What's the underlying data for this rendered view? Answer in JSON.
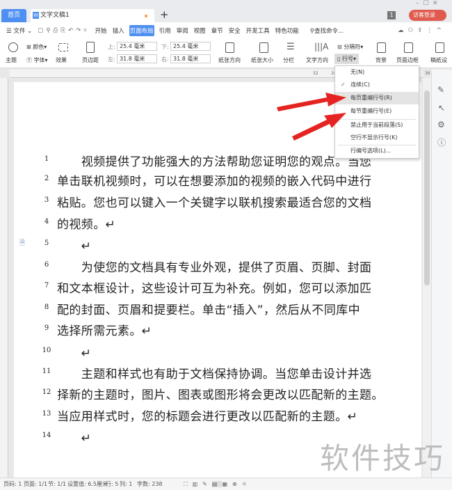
{
  "tabs": {
    "home": "首页",
    "doc": "文字文稿1",
    "badge": "1",
    "login": "访客登录",
    "new_tab": "+"
  },
  "menu": {
    "file": "文件",
    "items": [
      "开始",
      "插入",
      "页面布局",
      "引用",
      "审阅",
      "视图",
      "章节",
      "安全",
      "开发工具",
      "特色功能"
    ],
    "active": "页面布局",
    "search": "查找命令..."
  },
  "ribbon": {
    "theme": "主题",
    "color": "颜色",
    "font": "字体",
    "effect": "效果",
    "margins": "页边距",
    "top_label": "上:",
    "top": "25.4 毫米",
    "bottom_label": "下:",
    "bottom": "25.4 毫米",
    "left_label": "左:",
    "left": "31.8 毫米",
    "right_label": "右:",
    "right": "31.8 毫米",
    "orientation": "纸张方向",
    "size": "纸张大小",
    "columns": "分栏",
    "text_dir": "文字方向",
    "breaks": "分隔符",
    "line_numbers": "行号",
    "background": "背景",
    "page_border": "页面边框",
    "manuscript": "稿纸设"
  },
  "ruler": [
    "32",
    "34",
    "36"
  ],
  "dropdown": {
    "items": [
      "无(N)",
      "连续(C)",
      "每页重编行号(R)",
      "每节重编行号(E)",
      "禁止用于当前段落(S)",
      "空行不显示行号(K)",
      "行编号选项(L)..."
    ],
    "checked": "连续(C)",
    "highlighted": "每页重编行号(R)"
  },
  "document": {
    "lines": [
      {
        "n": "1",
        "t": "　　视频提供了功能强大的方法帮助您证明您的观点。当您"
      },
      {
        "n": "2",
        "t": "单击联机视频时，可以在想要添加的视频的嵌入代码中进行"
      },
      {
        "n": "3",
        "t": "粘贴。您也可以键入一个关键字以联机搜索最适合您的文档"
      },
      {
        "n": "4",
        "t": "的视频。↵"
      },
      {
        "n": "5",
        "t": "　　↵"
      },
      {
        "n": "6",
        "t": "　　为使您的文档具有专业外观，提供了页眉、页脚、封面"
      },
      {
        "n": "7",
        "t": "和文本框设计，这些设计可互为补充。例如，您可以添加匹"
      },
      {
        "n": "8",
        "t": "配的封面、页眉和提要栏。单击“插入”，然后从不同库中"
      },
      {
        "n": "9",
        "t": "选择所需元素。↵"
      },
      {
        "n": "10",
        "t": "　　↵"
      },
      {
        "n": "11",
        "t": "　　主题和样式也有助于文档保持协调。当您单击设计并选"
      },
      {
        "n": "12",
        "t": "择新的主题时，图片、图表或图形将会更改以匹配新的主题。"
      },
      {
        "n": "13",
        "t": "当应用样式时，您的标题会进行更改以匹配新的主题。↵"
      },
      {
        "n": "14",
        "t": "　　↵"
      }
    ]
  },
  "status": {
    "page": "页码: 1",
    "pages": "页面: 1/1",
    "section": "节: 1/1",
    "setting": "设置值: 6.5厘米",
    "row": "行: 5",
    "col": "列: 1",
    "words": "字数: 238"
  },
  "watermark": "软件技巧",
  "colors": {
    "accent": "#4e8ff2",
    "arrow": "#e52421",
    "login": "#e05a4f"
  }
}
